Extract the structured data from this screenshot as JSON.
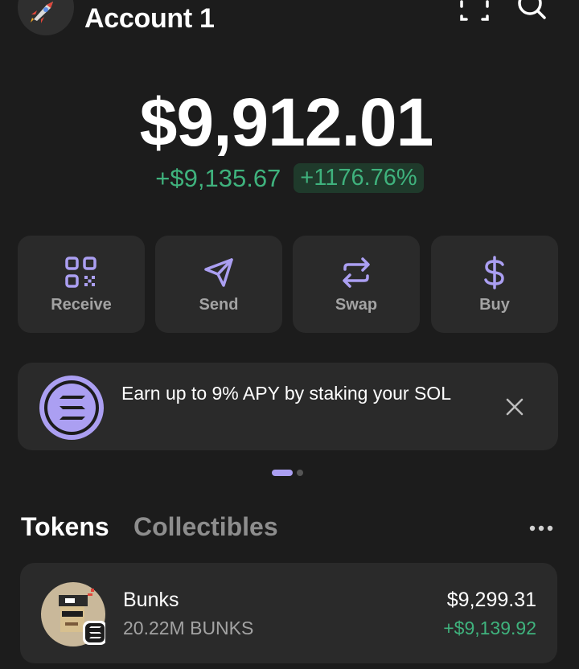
{
  "header": {
    "account_name": "Account 1",
    "avatar_icon": "rocket-icon",
    "scan_icon": "scan-icon",
    "search_icon": "search-icon"
  },
  "balance": {
    "total": "$9,912.01",
    "change_amount": "+$9,135.67",
    "change_percent": "+1176.76%"
  },
  "actions": [
    {
      "label": "Receive",
      "icon": "qr-code-icon"
    },
    {
      "label": "Send",
      "icon": "send-arrow-icon"
    },
    {
      "label": "Swap",
      "icon": "swap-arrows-icon"
    },
    {
      "label": "Buy",
      "icon": "dollar-icon"
    }
  ],
  "banner": {
    "text": "Earn up to 9% APY by staking your SOL",
    "icon": "solana-logo-icon",
    "close_icon": "close-icon"
  },
  "pager": {
    "pages": 2,
    "active": 1
  },
  "tabs": {
    "tokens": "Tokens",
    "collectibles": "Collectibles",
    "active": "Tokens"
  },
  "tokens": [
    {
      "name": "Bunks",
      "amount": "20.22M BUNKS",
      "value": "$9,299.31",
      "change": "+$9,139.92"
    }
  ],
  "colors": {
    "background": "#1c1c1c",
    "card": "#2a2a2a",
    "accent": "#ab9ff2",
    "positive": "#3fb27d"
  }
}
